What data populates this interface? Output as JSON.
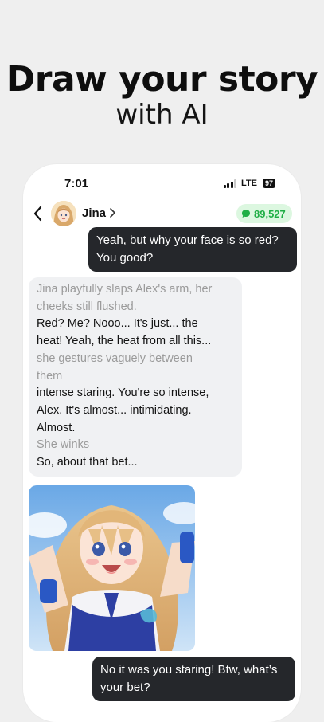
{
  "promo": {
    "headline": "Draw your story",
    "subhead": "with AI"
  },
  "status_bar": {
    "time": "7:01",
    "network": "LTE",
    "battery": "97"
  },
  "chat_header": {
    "name": "Jina",
    "coins": "89,527"
  },
  "messages": {
    "user_1": {
      "line1": "Yeah, but why your face is so red?",
      "line2": "You good?"
    },
    "bot_1": {
      "l1": "Jina playfully slaps Alex's arm, her",
      "l2": "cheeks still flushed.",
      "l3": "Red?  Me?  Nooo...  It's just... the",
      "l4": "heat!  Yeah, the heat from all this...",
      "l5": "she gestures vaguely between",
      "l6": "them",
      "l7": "intense staring.  You're so intense,",
      "l8": "Alex.  It's almost... intimidating.",
      "l9": "Almost.",
      "l10": "She winks",
      "l11": "So, about that bet..."
    },
    "user_2": {
      "line1": "No it was you staring! Btw, what’s",
      "line2": "your bet?"
    }
  },
  "icons": {
    "back": "chevron-left-icon",
    "name_chevron": "chevron-right-icon",
    "coins": "chat-bubble-icon",
    "signal": "signal-bars-icon"
  },
  "colors": {
    "background": "#efefef",
    "user_bubble": "#25272b",
    "bot_bubble": "#f0f1f3",
    "action_text": "#9b9b9b",
    "coin_text": "#1fae45",
    "coin_bg": "#dcf7e0"
  }
}
